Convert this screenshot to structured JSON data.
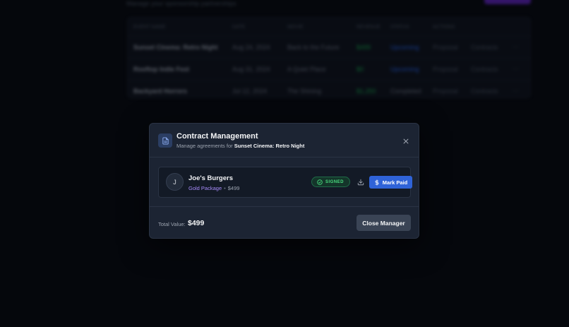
{
  "background": {
    "subtitle": "Manage your sponsorship partnerships",
    "rows": [
      {
        "event": "Sunset Cinema: Retro Night",
        "date": "Aug 24, 2024",
        "theme": "Back to the Future",
        "revenue": "$499",
        "status": "Upcoming",
        "action1": "Proposal",
        "action2": "Contracts"
      },
      {
        "event": "Rooftop Indie Fest",
        "date": "Aug 31, 2024",
        "theme": "A Quiet Place",
        "revenue": "$0",
        "status": "Upcoming",
        "action1": "Proposal",
        "action2": "Contracts"
      },
      {
        "event": "Backyard Horrors",
        "date": "Jul 12, 2024",
        "theme": "The Shining",
        "revenue": "$1,250",
        "status": "Completed",
        "action1": "Proposal",
        "action2": "Contracts"
      }
    ],
    "headers": [
      "EVENT NAME",
      "DATE",
      "MOVIE",
      "REVENUE",
      "STATUS",
      "ACTIONS"
    ]
  },
  "modal": {
    "title": "Contract Management",
    "subtitle_prefix": "Manage agreements for",
    "event_name": "Sunset Cinema: Retro Night",
    "contract": {
      "avatar_initial": "J",
      "sponsor": "Joe's Burgers",
      "package": "Gold Package",
      "separator": "•",
      "price": "$499",
      "status": "SIGNED",
      "mark_paid_label": "Mark Paid"
    },
    "footer": {
      "total_label": "Total Value:",
      "total_value": "$499",
      "close_label": "Close Manager"
    }
  },
  "colors": {
    "accent_blue": "#2f63d8",
    "signed_green": "#4ade80",
    "package_purple": "#a78bfa"
  },
  "icons": [
    "document-icon",
    "close-icon",
    "check-circle-icon",
    "download-icon",
    "dollar-icon"
  ]
}
